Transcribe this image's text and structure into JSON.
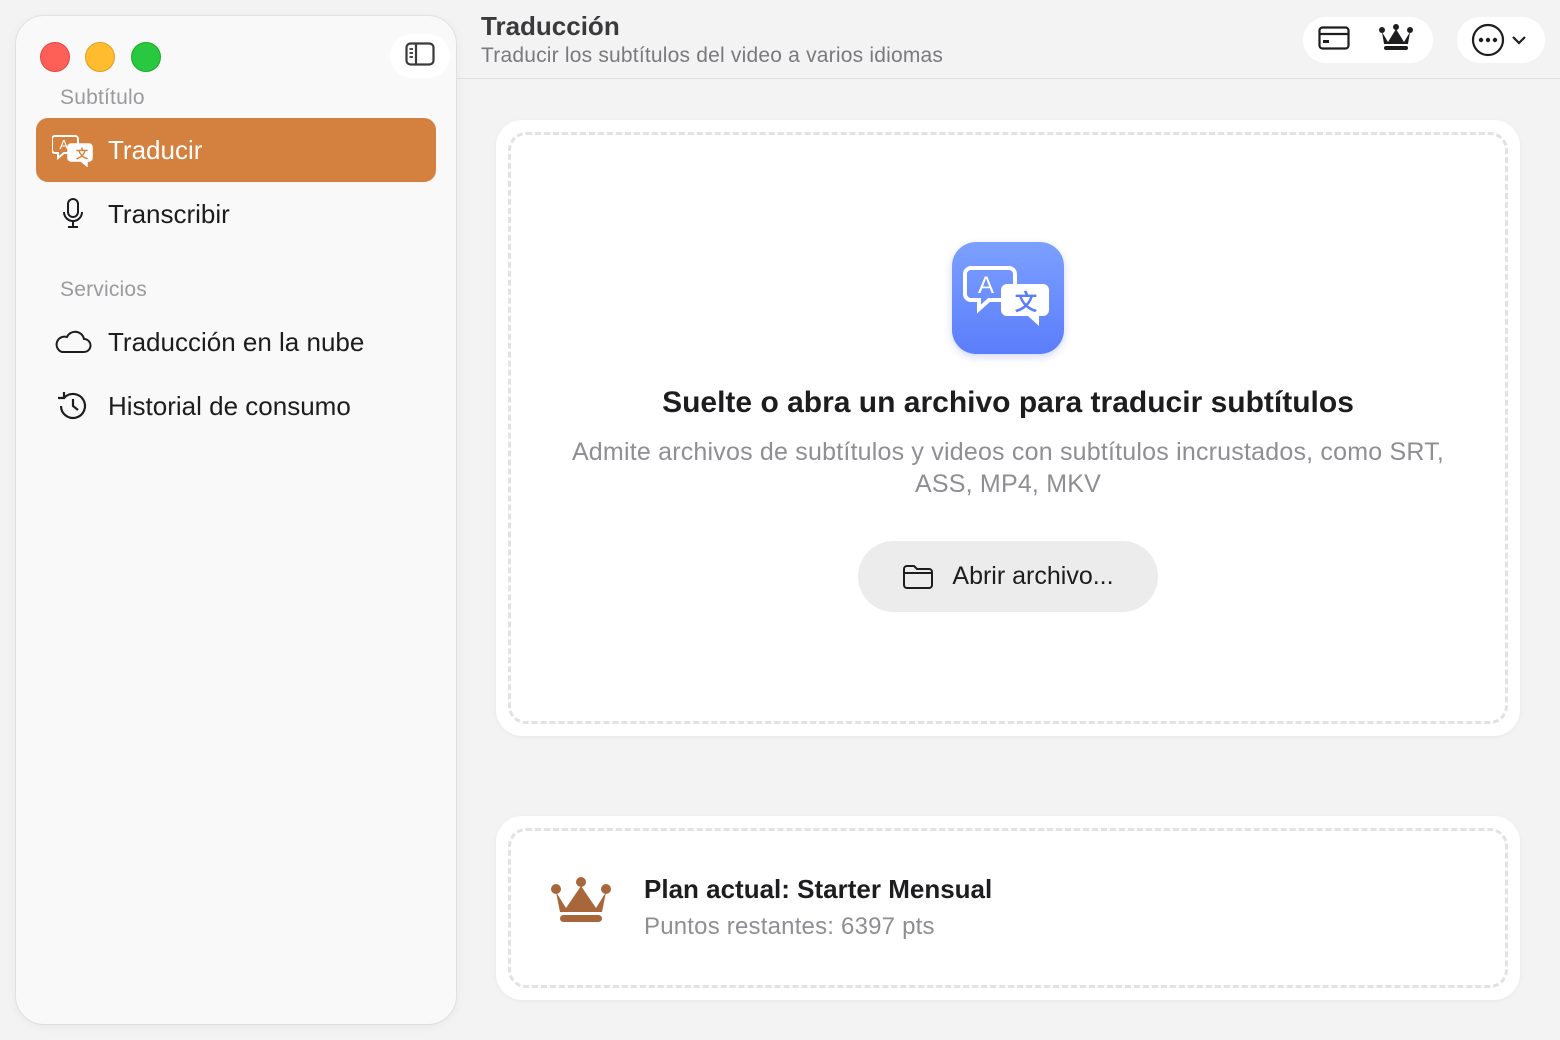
{
  "header": {
    "title": "Traducción",
    "subtitle": "Traducir los subtítulos del video a varios idiomas"
  },
  "sidebar": {
    "sections": [
      {
        "label": "Subtítulo",
        "items": [
          {
            "label": "Traducir",
            "icon": "translate-icon",
            "active": true
          },
          {
            "label": "Transcribir",
            "icon": "microphone-icon",
            "active": false
          }
        ]
      },
      {
        "label": "Servicios",
        "items": [
          {
            "label": "Traducción en la nube",
            "icon": "cloud-icon",
            "active": false
          },
          {
            "label": "Historial de consumo",
            "icon": "history-icon",
            "active": false
          }
        ]
      }
    ]
  },
  "toolbar": {
    "buttons": [
      "card-icon",
      "crown-icon",
      "more-icon",
      "chevron-down-icon"
    ]
  },
  "drop_zone": {
    "title": "Suelte o abra un archivo para traducir subtítulos",
    "description": "Admite archivos de subtítulos y videos con subtítulos incrustados, como SRT, ASS, MP4, MKV",
    "button_label": "Abrir archivo..."
  },
  "plan": {
    "title": "Plan actual: Starter Mensual",
    "points": "Puntos restantes: 6397 pts"
  },
  "colors": {
    "accent": "#d4813f",
    "app_icon": "#6b8dfd",
    "crown": "#a8673a"
  }
}
